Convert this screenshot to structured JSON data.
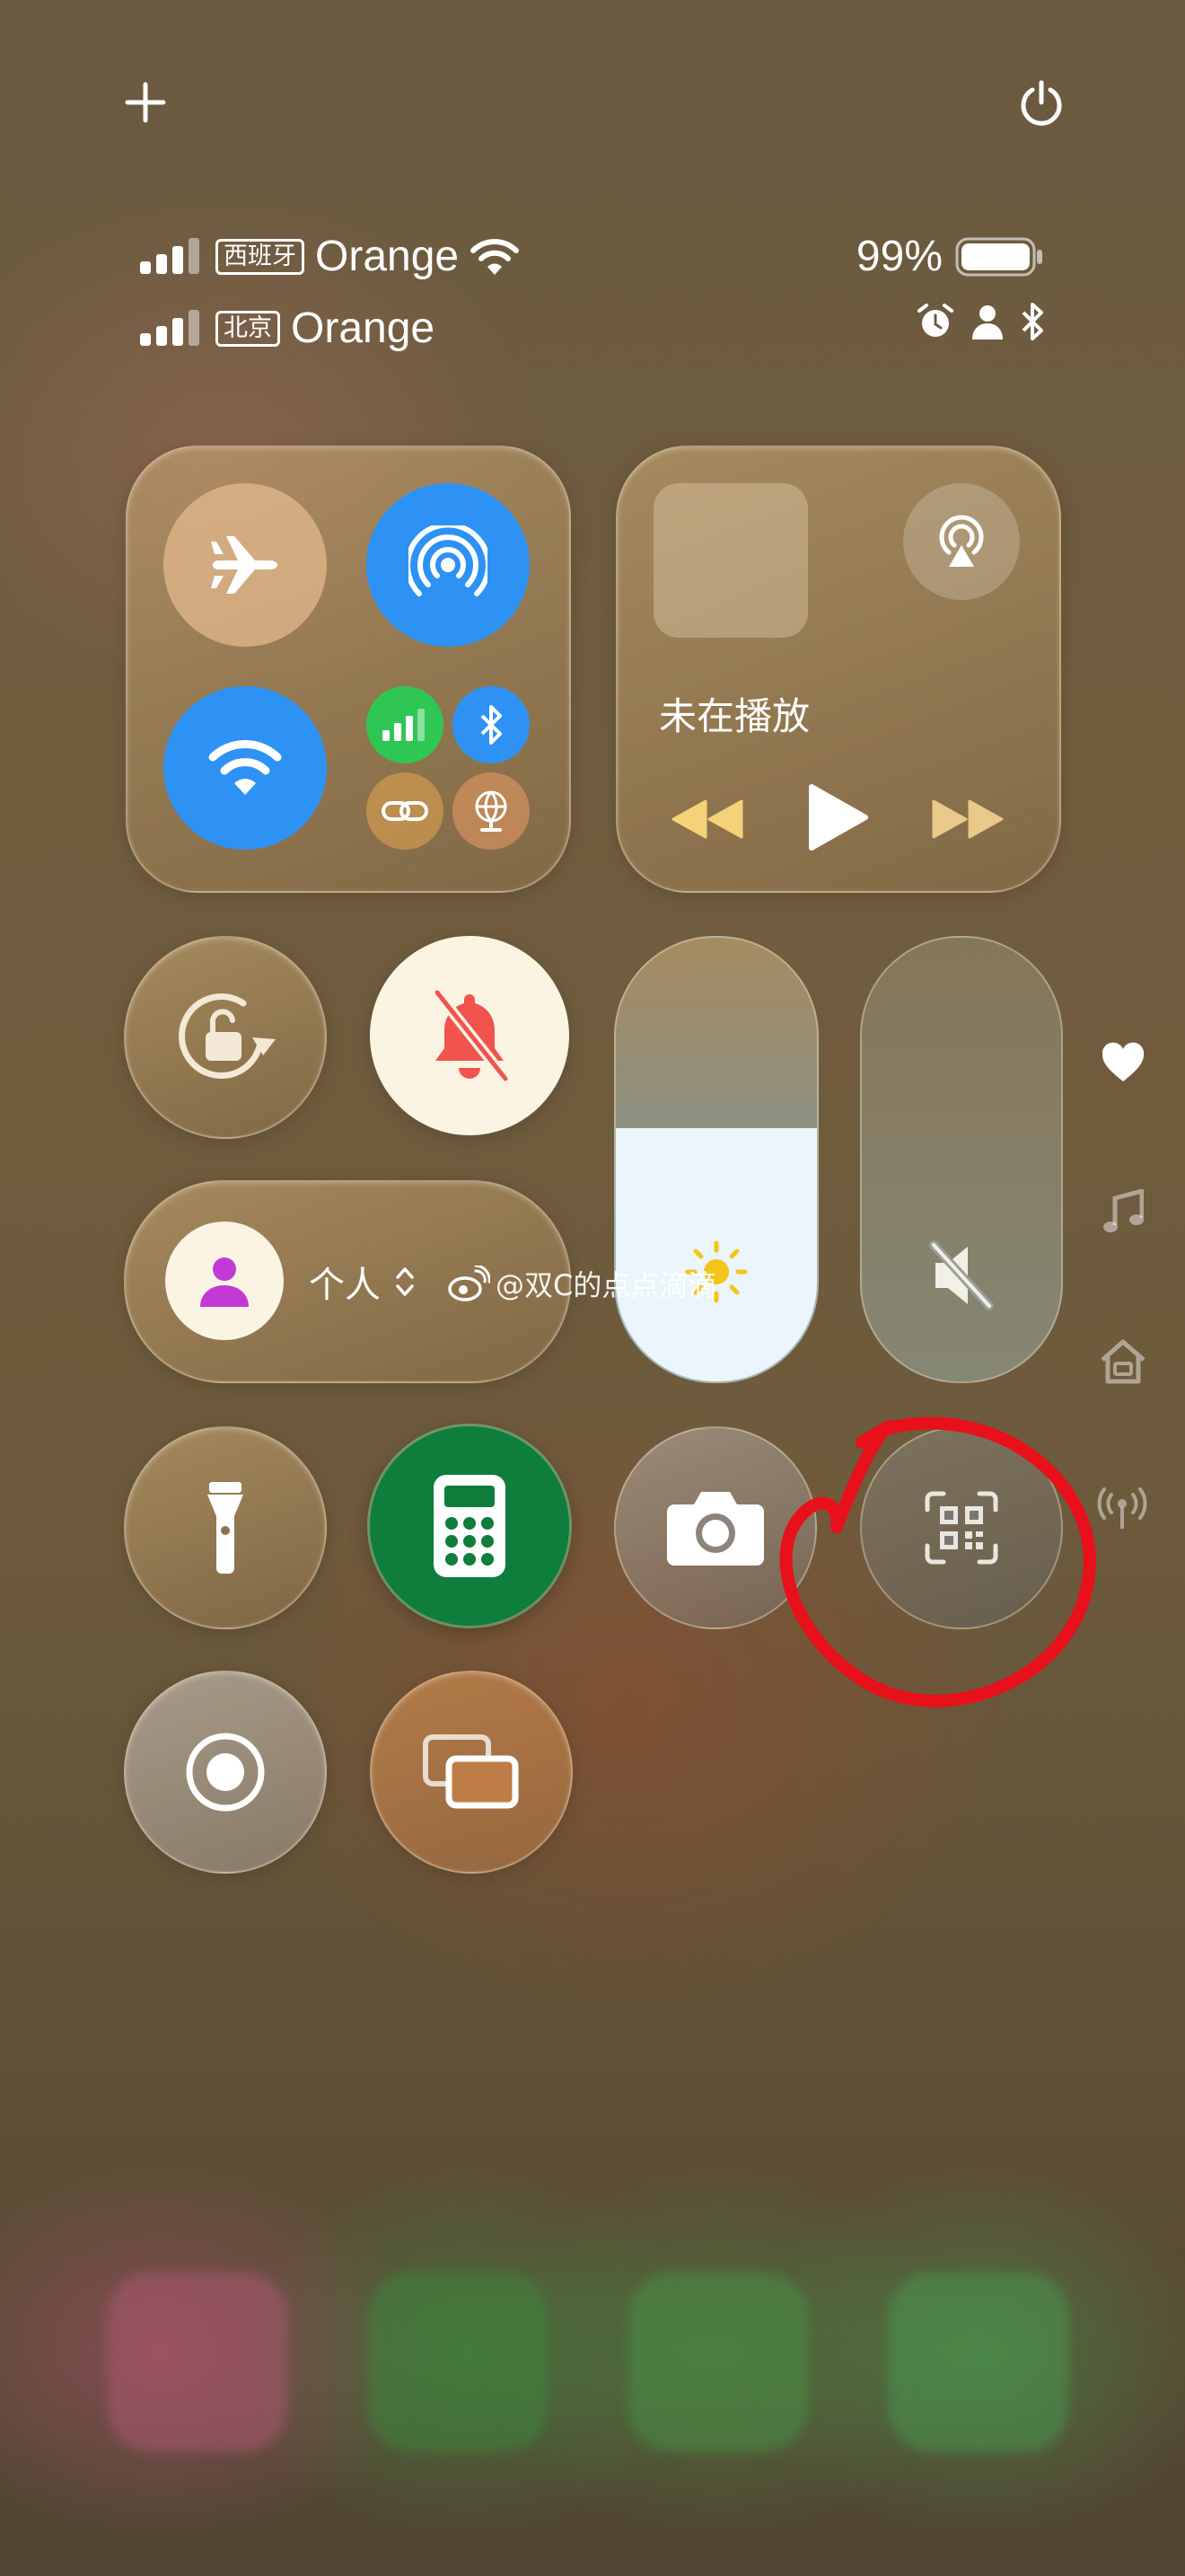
{
  "status": {
    "sim1": {
      "region": "西班牙",
      "carrier": "Orange"
    },
    "sim2": {
      "region": "北京",
      "carrier": "Orange"
    },
    "battery": "99%"
  },
  "media": {
    "now_playing": "未在播放"
  },
  "focus": {
    "label": "个人"
  },
  "watermark": "@双C的点点滴滴",
  "colors": {
    "accent_blue": "#2e92f5",
    "cellular_green": "#2fc653",
    "calculator_green": "#0f7d3c",
    "annotation_red": "#e8101a"
  }
}
